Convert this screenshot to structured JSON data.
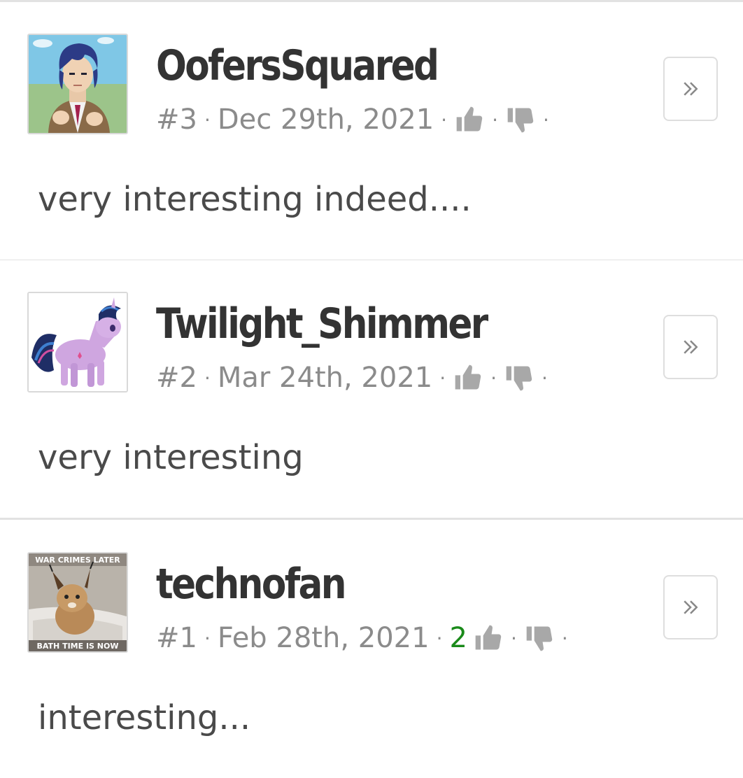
{
  "comments": [
    {
      "username": "OofersSquared",
      "number": "#3",
      "date": "Dec 29th, 2021",
      "score": "",
      "body": "very interesting indeed....",
      "avatar_icon": "anime-character-avatar"
    },
    {
      "username": "Twilight_Shimmer",
      "number": "#2",
      "date": "Mar 24th, 2021",
      "score": "",
      "body": "very interesting",
      "avatar_icon": "pony-avatar"
    },
    {
      "username": "technofan",
      "number": "#1",
      "date": "Feb 28th, 2021",
      "score": "2",
      "body": "interesting...",
      "avatar_icon": "caracal-meme-avatar",
      "avatar_caption_top": "WAR CRIMES LATER",
      "avatar_caption_bottom": "BATH TIME IS NOW"
    }
  ],
  "separator": "·",
  "icons": {
    "upvote": "thumbs-up-icon",
    "downvote": "thumbs-down-icon",
    "expand": "double-chevron-right-icon"
  },
  "colors": {
    "username": "#333333",
    "meta": "#8b8b8b",
    "score_positive": "#1a8a1a",
    "body": "#4a4a4a",
    "divider": "#e2e2e2"
  }
}
